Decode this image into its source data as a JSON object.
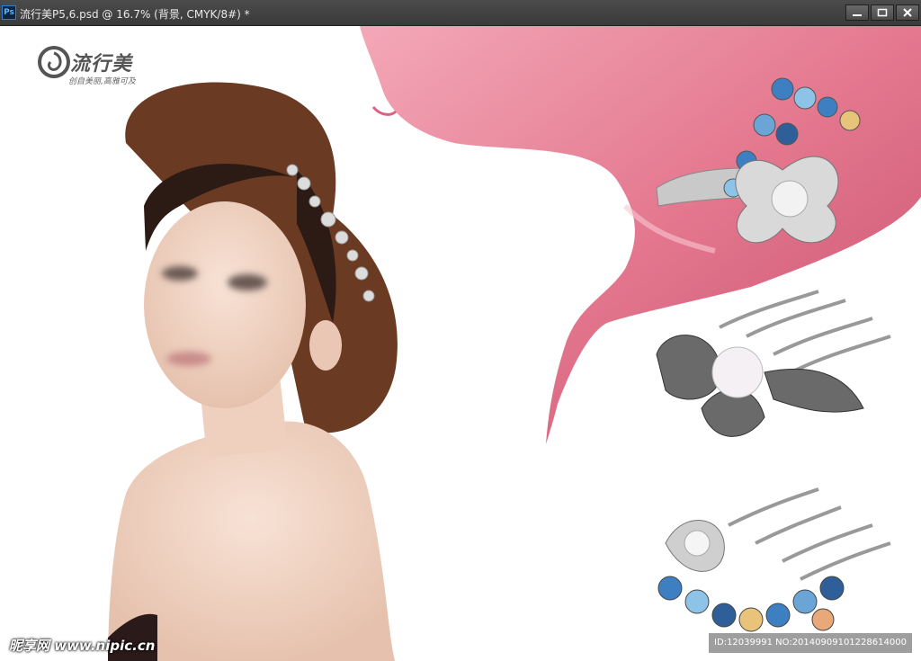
{
  "window": {
    "app_icon": "photoshop-icon",
    "app_icon_text": "Ps",
    "title": "流行美P5,6.psd @ 16.7% (背景, CMYK/8#) *",
    "controls": [
      "minimize-icon",
      "maximize-icon",
      "close-icon"
    ]
  },
  "canvas": {
    "logo": {
      "icon": "swirl-logo-icon",
      "brand": "流行美",
      "slogan": "创自美丽,高雅可及"
    },
    "watermark": "昵享网 www.nipic.cn",
    "image_id": "ID:12039991 NO:20140909101228614000"
  },
  "colors": {
    "titlebar": "#404040",
    "pink": "#e4788f",
    "hair": "#6b3a22"
  }
}
